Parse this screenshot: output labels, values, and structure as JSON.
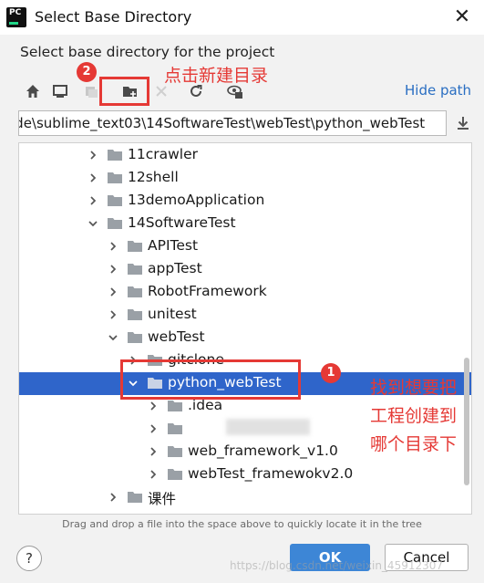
{
  "window": {
    "title": "Select Base Directory",
    "app_icon_text": "PC",
    "close_glyph": "✕"
  },
  "subtitle": "Select base directory for the project",
  "toolbar": {
    "icons": [
      "home-icon",
      "desktop-icon",
      "project-icon",
      "new-folder-icon",
      "delete-icon",
      "refresh-icon",
      "show-hidden-icon"
    ],
    "hide_path_label": "Hide path"
  },
  "path": {
    "value": "ode\\sublime_text03\\14SoftwareTest\\webTest\\python_webTest"
  },
  "tree": {
    "rows": [
      {
        "label": "11crawler",
        "depth": 0,
        "expanded": false,
        "selected": false
      },
      {
        "label": "12shell",
        "depth": 0,
        "expanded": false,
        "selected": false
      },
      {
        "label": "13demoApplication",
        "depth": 0,
        "expanded": false,
        "selected": false
      },
      {
        "label": "14SoftwareTest",
        "depth": 0,
        "expanded": true,
        "selected": false
      },
      {
        "label": "APITest",
        "depth": 1,
        "expanded": false,
        "selected": false
      },
      {
        "label": "appTest",
        "depth": 1,
        "expanded": false,
        "selected": false
      },
      {
        "label": "RobotFramework",
        "depth": 1,
        "expanded": false,
        "selected": false
      },
      {
        "label": "unitest",
        "depth": 1,
        "expanded": false,
        "selected": false
      },
      {
        "label": "webTest",
        "depth": 1,
        "expanded": true,
        "selected": false
      },
      {
        "label": "gitclone",
        "depth": 2,
        "expanded": false,
        "selected": false
      },
      {
        "label": "python_webTest",
        "depth": 2,
        "expanded": true,
        "selected": true
      },
      {
        "label": ".idea",
        "depth": 3,
        "expanded": false,
        "selected": false
      },
      {
        "label": "",
        "depth": 3,
        "expanded": false,
        "selected": false
      },
      {
        "label": "web_framework_v1.0",
        "depth": 3,
        "expanded": false,
        "selected": false
      },
      {
        "label": "webTest_framewokv2.0",
        "depth": 3,
        "expanded": false,
        "selected": false
      },
      {
        "label": "课件",
        "depth": 1,
        "expanded": false,
        "selected": false
      }
    ]
  },
  "hint": "Drag and drop a file into the space above to quickly locate it in the tree",
  "buttons": {
    "help": "?",
    "ok": "OK",
    "cancel": "Cancel"
  },
  "annotations": {
    "badge_1": "1",
    "badge_2": "2",
    "new_folder_note": "点击新建目录",
    "target_note_lines": [
      "找到想要把",
      "工程创建到",
      "哪个目录下"
    ]
  },
  "watermark": "https://blog.csdn.net/weixin_45912307",
  "colors": {
    "selection": "#2f65ca",
    "annotation": "#e53935",
    "link": "#2a6ec2",
    "ok_button": "#3d86d6",
    "folder": "#9aa0a6"
  }
}
